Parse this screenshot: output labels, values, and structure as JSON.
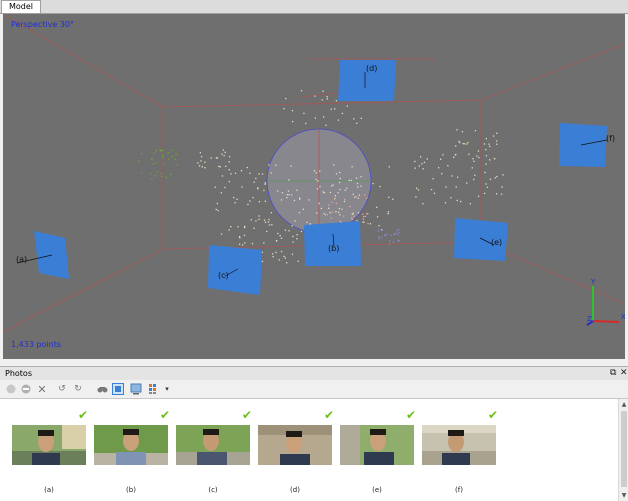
{
  "tab": {
    "label": "Model"
  },
  "viewport": {
    "projection_label": "Perspective 30°",
    "points_label": "1,433 points",
    "camera_labels": [
      "(a)",
      "(b)",
      "(c)",
      "(d)",
      "(e)",
      "(f)"
    ],
    "axis_labels": {
      "x": "X",
      "y": "Y",
      "z": "Z"
    },
    "colors": {
      "background": "#6f6f6f",
      "camera": "#3b7ed6",
      "grid": "#b04a4a",
      "label": "#1f2fd6"
    }
  },
  "photos_panel": {
    "title": "Photos",
    "restore_icon": "restore-icon",
    "close_icon": "close-icon",
    "toolbar_icons": [
      "enable-icon",
      "disable-icon",
      "remove-icon",
      "rotate-left-icon",
      "rotate-right-icon",
      "binoculars-icon",
      "image-view-icon",
      "details-view-icon",
      "grid-view-icon",
      "dropdown-icon"
    ]
  },
  "photos": [
    {
      "caption": "(a)",
      "checked": true
    },
    {
      "caption": "(b)",
      "checked": true
    },
    {
      "caption": "(c)",
      "checked": true
    },
    {
      "caption": "(d)",
      "checked": true
    },
    {
      "caption": "(e)",
      "checked": true
    },
    {
      "caption": "(f)",
      "checked": true
    }
  ]
}
